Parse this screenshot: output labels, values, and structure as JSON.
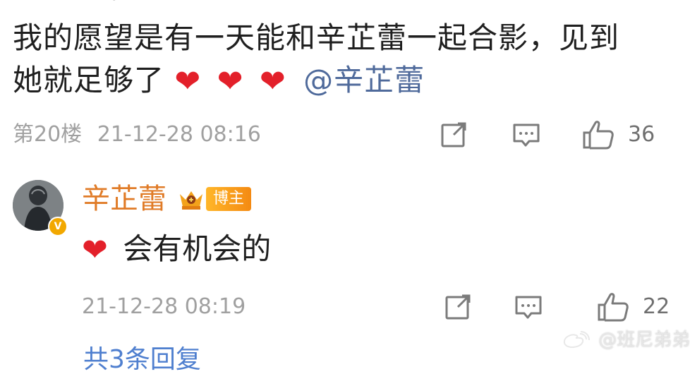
{
  "top_fragment": "⌄",
  "comment": {
    "line1": "我的愿望是有一天能和辛芷蕾一起合影，见到",
    "line2_prefix": "她就足够了",
    "hearts": [
      "❤",
      "❤",
      "❤"
    ],
    "mention": "@辛芷蕾"
  },
  "comment_meta": {
    "floor": "第20楼",
    "time": "21-12-28 08:16",
    "share_icon": "share-icon",
    "comment_icon": "comment-icon",
    "like_icon": "thumbs-up-icon",
    "like_count": "36"
  },
  "reply": {
    "avatar_icon": "avatar",
    "verified_mark": "V",
    "name": "辛芷蕾",
    "crown_icon": "crown-icon",
    "badge": "博主",
    "heart": "❤",
    "text": "会有机会的",
    "time": "21-12-28 08:19",
    "share_icon": "share-icon",
    "comment_icon": "comment-icon",
    "like_icon": "thumbs-up-icon",
    "like_count": "22"
  },
  "watermark": "@班尼弟弟",
  "bottom_fragment": "共3条回复",
  "colors": {
    "name_orange": "#e07b27",
    "heart_red": "#e3202a",
    "mention_blue": "#4f6a9b",
    "meta_gray": "#a0a0a0"
  }
}
